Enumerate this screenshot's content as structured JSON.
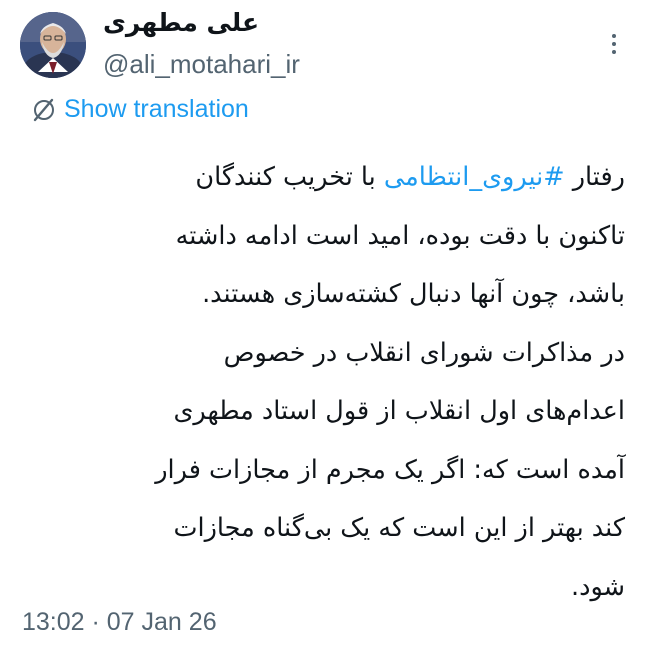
{
  "author": {
    "name": "علی مطهری",
    "handle": "@ali_motahari_ir"
  },
  "icons": {
    "more": "more-dots-icon",
    "translate": "translate-globe-icon"
  },
  "translation": {
    "label": "Show translation"
  },
  "tweet": {
    "line1_before": "رفتار ",
    "hashtag": "#نیروی_انتظامی",
    "line1_after": " با تخریب کنندگان",
    "lines": [
      "تاکنون با دقت بوده، امید است ادامه داشته",
      "باشد، چون آنها دنبال کشته‌سازی هستند.",
      "در مذاکرات شورای انقلاب در خصوص",
      "اعدام‌های اول انقلاب از قول استاد مطهری",
      "آمده است که: اگر یک مجرم از مجازات فرار",
      "کند بهتر از این است که یک بی‌گناه مجازات",
      "شود."
    ]
  },
  "meta": {
    "timestamp": "13:02 · 07 Jan 26"
  },
  "colors": {
    "link": "#1d9bf0",
    "secondary_text": "#536471",
    "primary_text": "#0f1419"
  }
}
